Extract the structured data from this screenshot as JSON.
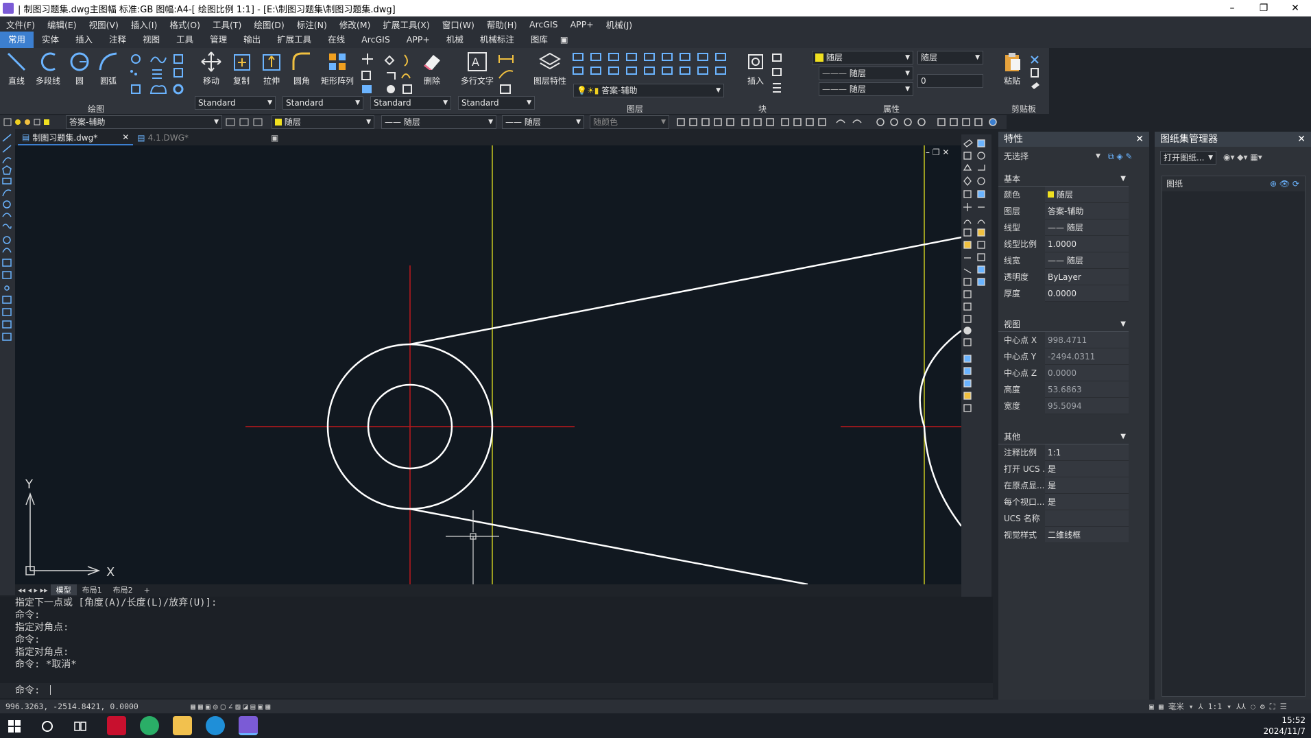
{
  "window": {
    "title": "| 制图习题集.dwg主图幅  标准:GB 图幅:A4-[ 绘图比例 1:1] - [E:\\制图习题集\\制图习题集.dwg]",
    "minimize": "–",
    "restore": "❐",
    "close": "✕"
  },
  "menu": [
    "文件(F)",
    "编辑(E)",
    "视图(V)",
    "插入(I)",
    "格式(O)",
    "工具(T)",
    "绘图(D)",
    "标注(N)",
    "修改(M)",
    "扩展工具(X)",
    "窗口(W)",
    "帮助(H)",
    "ArcGIS",
    "APP+",
    "机械(J)"
  ],
  "ribbon_tabs": [
    "常用",
    "实体",
    "插入",
    "注释",
    "视图",
    "工具",
    "管理",
    "输出",
    "扩展工具",
    "在线",
    "ArcGIS",
    "APP+",
    "机械",
    "机械标注",
    "图库"
  ],
  "active_tab": "常用",
  "ribbon": {
    "draw_buttons": [
      "直线",
      "多段线",
      "圆",
      "圆弧"
    ],
    "modify_buttons": [
      "移动",
      "复制",
      "拉伸",
      "圆角",
      "矩形阵列",
      "删除"
    ],
    "annot_buttons": [
      "多行文字"
    ],
    "layer_buttons": [
      "图层特性"
    ],
    "block_buttons": [
      "插入"
    ],
    "clip_buttons": [
      "粘贴"
    ],
    "groups": [
      "绘图",
      "图层",
      "块",
      "属性",
      "剪贴板"
    ],
    "styles": [
      "Standard",
      "Standard",
      "Standard",
      "Standard"
    ],
    "layer_current": "答案-辅助",
    "prop_color": "随层",
    "prop_linetype": "随层",
    "prop_lineweight": "随层",
    "prop_layer": "随层",
    "prop_value": "0"
  },
  "layerbar": {
    "layer": "答案-辅助",
    "color": "随层",
    "linetype": "—— 随层",
    "lineweight": "—— 随层",
    "plotstyle": "随颜色"
  },
  "file_tabs": [
    {
      "name": "制图习题集.dwg*",
      "active": true
    },
    {
      "name": "4.1.DWG*",
      "active": false
    }
  ],
  "canvas": {
    "ucs_x": "X",
    "ucs_y": "Y"
  },
  "layout_tabs": [
    "模型",
    "布局1",
    "布局2",
    "+"
  ],
  "command_history": [
    "指定下一点或 [角度(A)/长度(L)/放弃(U)]:",
    "命令:",
    "指定对角点:",
    "命令:",
    "指定对角点:",
    "命令: *取消*"
  ],
  "command_prompt": "命令:",
  "coords": "996.3263, -2514.8421, 0.0000",
  "properties": {
    "title": "特性",
    "selection": "无选择",
    "sections": [
      {
        "name": "基本",
        "rows": [
          {
            "k": "颜色",
            "v": "随层"
          },
          {
            "k": "图层",
            "v": "答案-辅助"
          },
          {
            "k": "线型",
            "v": "—— 随层"
          },
          {
            "k": "线型比例",
            "v": "1.0000"
          },
          {
            "k": "线宽",
            "v": "—— 随层"
          },
          {
            "k": "透明度",
            "v": "ByLayer"
          },
          {
            "k": "厚度",
            "v": "0.0000"
          }
        ]
      },
      {
        "name": "视图",
        "rows": [
          {
            "k": "中心点 X",
            "v": "998.4711"
          },
          {
            "k": "中心点 Y",
            "v": "-2494.0311"
          },
          {
            "k": "中心点 Z",
            "v": "0.0000"
          },
          {
            "k": "高度",
            "v": "53.6863"
          },
          {
            "k": "宽度",
            "v": "95.5094"
          }
        ]
      },
      {
        "name": "其他",
        "rows": [
          {
            "k": "注释比例",
            "v": "1:1"
          },
          {
            "k": "打开 UCS ...",
            "v": "是"
          },
          {
            "k": "在原点显...",
            "v": "是"
          },
          {
            "k": "每个视口...",
            "v": "是"
          },
          {
            "k": "UCS 名称",
            "v": ""
          },
          {
            "k": "视觉样式",
            "v": "二维线框"
          }
        ]
      }
    ]
  },
  "sheet_manager": {
    "title": "图纸集管理器",
    "open_label": "打开图纸...",
    "tree_label": "图纸"
  },
  "status_right": {
    "units": "毫米",
    "scale": "1:1"
  },
  "clock": {
    "time": "15:52",
    "date": "2024/11/7"
  },
  "colors": {
    "accent": "#3c7fd0",
    "bg": "#111820",
    "red_center": "#c0181c",
    "yellow": "#d8d82a"
  }
}
